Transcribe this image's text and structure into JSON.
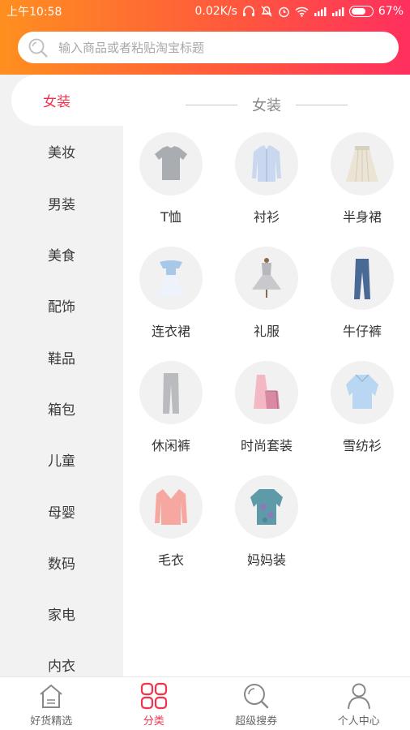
{
  "status_bar": {
    "time": "上午10:58",
    "network_speed": "0.02K/s",
    "battery_percent": "67%",
    "battery_level": 0.67
  },
  "search": {
    "placeholder": "输入商品或者粘贴淘宝标题"
  },
  "sidebar": {
    "items": [
      {
        "label": "女装",
        "active": true
      },
      {
        "label": "美妆"
      },
      {
        "label": "男装"
      },
      {
        "label": "美食"
      },
      {
        "label": "配饰"
      },
      {
        "label": "鞋品"
      },
      {
        "label": "箱包"
      },
      {
        "label": "儿童"
      },
      {
        "label": "母婴"
      },
      {
        "label": "数码"
      },
      {
        "label": "家电"
      },
      {
        "label": "内衣"
      }
    ]
  },
  "content": {
    "section_title": "女装",
    "categories": [
      {
        "label": "T恤",
        "icon": "tshirt-icon"
      },
      {
        "label": "衬衫",
        "icon": "shirt-icon"
      },
      {
        "label": "半身裙",
        "icon": "skirt-icon"
      },
      {
        "label": "连衣裙",
        "icon": "dress-icon"
      },
      {
        "label": "礼服",
        "icon": "gown-icon"
      },
      {
        "label": "牛仔裤",
        "icon": "jeans-icon"
      },
      {
        "label": "休闲裤",
        "icon": "casual-pants-icon"
      },
      {
        "label": "时尚套装",
        "icon": "fashion-set-icon"
      },
      {
        "label": "雪纺衫",
        "icon": "chiffon-blouse-icon"
      },
      {
        "label": "毛衣",
        "icon": "sweater-icon"
      },
      {
        "label": "妈妈装",
        "icon": "mom-wear-icon"
      }
    ]
  },
  "tabbar": {
    "items": [
      {
        "label": "好货精选",
        "icon": "home-icon"
      },
      {
        "label": "分类",
        "icon": "category-grid-icon",
        "active": true
      },
      {
        "label": "超级搜券",
        "icon": "search-icon"
      },
      {
        "label": "个人中心",
        "icon": "user-icon"
      }
    ]
  },
  "colors": {
    "accent": "#f2334d",
    "header_gradient_start": "#ff8f1f",
    "header_gradient_end": "#ff2f5e"
  }
}
